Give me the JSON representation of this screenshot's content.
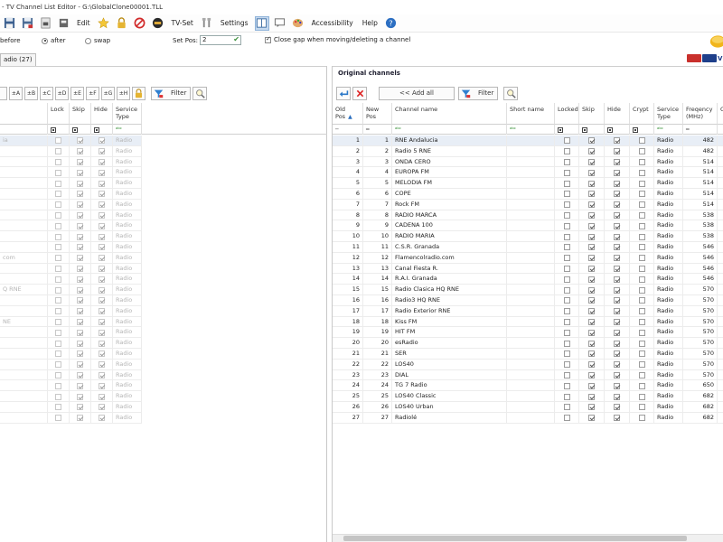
{
  "window": {
    "title": "- TV Channel List Editor  - G:\\GlobalClone00001.TLL"
  },
  "menu": {
    "edit": "Edit",
    "tvset": "TV-Set",
    "settings": "Settings",
    "accessibility": "Accessibility",
    "help": "Help"
  },
  "options": {
    "before": "before",
    "after": "after",
    "swap": "swap",
    "setpos_label": "Set Pos:",
    "setpos_value": "2",
    "close_gap": "Close gap when moving/deleting a channel"
  },
  "left": {
    "tab_label": "adio (27)",
    "sort_buttons": [
      "±A",
      "±B",
      "±C",
      "±D",
      "±E",
      "±F",
      "±G",
      "±H"
    ],
    "filter_label": "Filter",
    "columns": {
      "lock": "Lock",
      "skip": "Skip",
      "hide": "Hide",
      "service_type": "Service Type"
    },
    "name_fragments": [
      "ia",
      "",
      "",
      "",
      "",
      "",
      "",
      "",
      "",
      "",
      "",
      "com",
      "",
      "",
      "Q RNE",
      "",
      "",
      "NE",
      "",
      "",
      "",
      "",
      "",
      "",
      "",
      "",
      ""
    ],
    "service_type_value": "Radio"
  },
  "right": {
    "title": "Original channels",
    "add_all_label": "<< Add all",
    "filter_label": "Filter",
    "columns": {
      "old_pos": "Old Pos",
      "new_pos": "New Pos",
      "channel_name": "Channel name",
      "short_name": "Short name",
      "locked": "Locked",
      "skip": "Skip",
      "hide": "Hide",
      "crypt": "Crypt",
      "service_type": "Service Type",
      "frequency": "Freqency (MHz)",
      "extra": "C"
    },
    "rows": [
      {
        "pos": "1",
        "name": "RNE Andalucia",
        "type": "Radio",
        "freq": "482"
      },
      {
        "pos": "2",
        "name": "Radio 5 RNE",
        "type": "Radio",
        "freq": "482"
      },
      {
        "pos": "3",
        "name": "ONDA CERO",
        "type": "Radio",
        "freq": "514"
      },
      {
        "pos": "4",
        "name": "EUROPA FM",
        "type": "Radio",
        "freq": "514"
      },
      {
        "pos": "5",
        "name": "MELODIA FM",
        "type": "Radio",
        "freq": "514"
      },
      {
        "pos": "6",
        "name": "COPE",
        "type": "Radio",
        "freq": "514"
      },
      {
        "pos": "7",
        "name": "Rock FM",
        "type": "Radio",
        "freq": "514"
      },
      {
        "pos": "8",
        "name": "RADIO MARCA",
        "type": "Radio",
        "freq": "538"
      },
      {
        "pos": "9",
        "name": "CADENA 100",
        "type": "Radio",
        "freq": "538"
      },
      {
        "pos": "10",
        "name": "RADIO MARIA",
        "type": "Radio",
        "freq": "538"
      },
      {
        "pos": "11",
        "name": "C.S.R. Granada",
        "type": "Radio",
        "freq": "546"
      },
      {
        "pos": "12",
        "name": "Flamencolradio.com",
        "type": "Radio",
        "freq": "546"
      },
      {
        "pos": "13",
        "name": "Canal Fiesta R.",
        "type": "Radio",
        "freq": "546"
      },
      {
        "pos": "14",
        "name": "R.A.I. Granada",
        "type": "Radio",
        "freq": "546"
      },
      {
        "pos": "15",
        "name": "Radio Clasica HQ RNE",
        "type": "Radio",
        "freq": "570"
      },
      {
        "pos": "16",
        "name": "Radio3 HQ RNE",
        "type": "Radio",
        "freq": "570"
      },
      {
        "pos": "17",
        "name": "Radio Exterior RNE",
        "type": "Radio",
        "freq": "570"
      },
      {
        "pos": "18",
        "name": "Kiss FM",
        "type": "Radio",
        "freq": "570"
      },
      {
        "pos": "19",
        "name": "HIT FM",
        "type": "Radio",
        "freq": "570"
      },
      {
        "pos": "20",
        "name": "esRadio",
        "type": "Radio",
        "freq": "570"
      },
      {
        "pos": "21",
        "name": "SER",
        "type": "Radio",
        "freq": "570"
      },
      {
        "pos": "22",
        "name": "LOS40",
        "type": "Radio",
        "freq": "570"
      },
      {
        "pos": "23",
        "name": "DIAL",
        "type": "Radio",
        "freq": "570"
      },
      {
        "pos": "24",
        "name": "TG 7 Radio",
        "type": "Radio",
        "freq": "650"
      },
      {
        "pos": "25",
        "name": "LOS40 Classic",
        "type": "Radio",
        "freq": "682"
      },
      {
        "pos": "26",
        "name": "LOS40 Urban",
        "type": "Radio",
        "freq": "682"
      },
      {
        "pos": "27",
        "name": "Radiolé",
        "type": "Radio",
        "freq": "682"
      }
    ]
  },
  "colors": {
    "selection": "#e8eef6",
    "header_blue": "#2b6fbf",
    "filter_icon": "#2e7fd0"
  },
  "icons": [
    "save-icon",
    "save-as-icon",
    "import-icon",
    "reload-icon",
    "favorites-star-icon",
    "lock-icon",
    "block-icon",
    "tv-logo-icon",
    "wrench-icon",
    "panel-layout-icon",
    "chat-icon",
    "palette-icon",
    "help-icon",
    "add-all-arrow-icon",
    "delete-x-icon",
    "filter-funnel-icon",
    "search-magnifier-icon"
  ]
}
